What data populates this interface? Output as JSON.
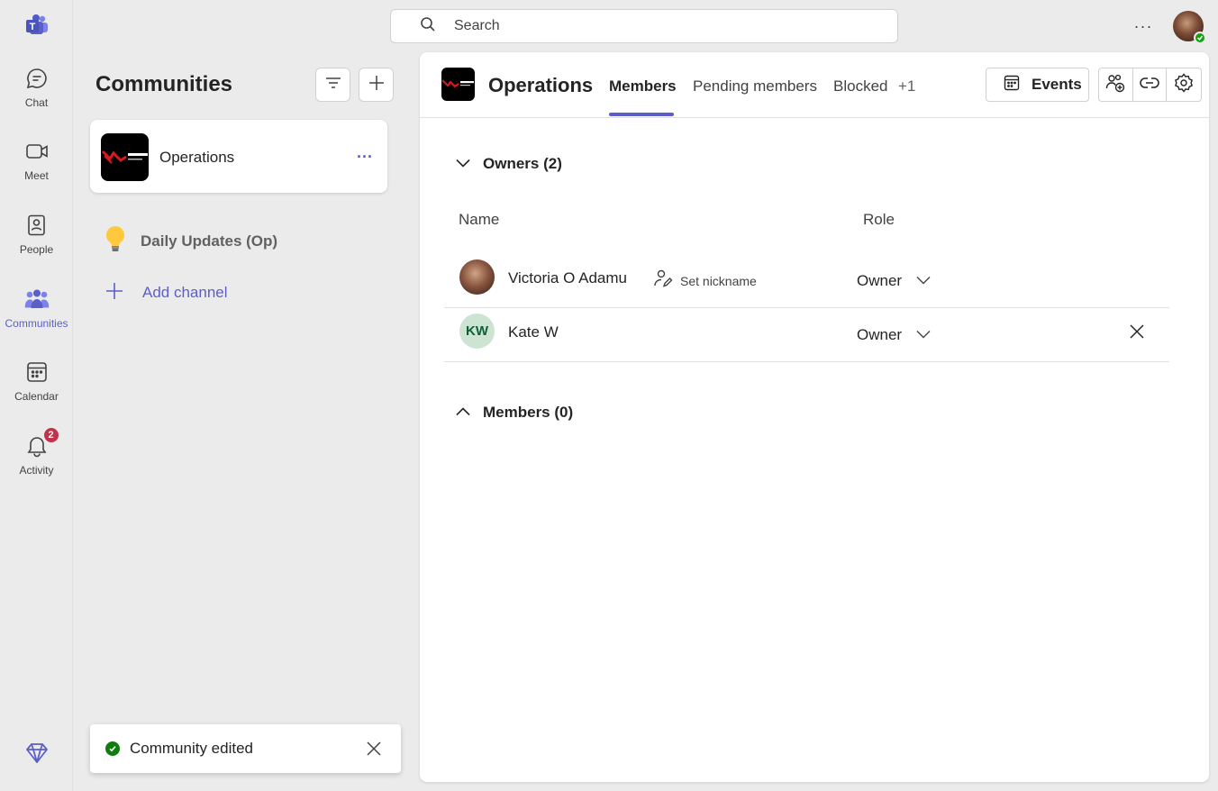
{
  "rail": {
    "items": [
      {
        "label": "Chat",
        "icon": "chat-icon"
      },
      {
        "label": "Meet",
        "icon": "video-icon"
      },
      {
        "label": "People",
        "icon": "contacts-icon"
      },
      {
        "label": "Communities",
        "icon": "communities-icon"
      },
      {
        "label": "Calendar",
        "icon": "calendar-icon"
      },
      {
        "label": "Activity",
        "icon": "bell-icon",
        "badge": "2"
      }
    ],
    "active": "Communities"
  },
  "search": {
    "placeholder": "Search"
  },
  "panel": {
    "title": "Communities",
    "community": {
      "name": "Operations"
    },
    "channels": [
      {
        "name": "Daily Updates (Op)"
      }
    ],
    "add_channel": "Add channel"
  },
  "toast": {
    "text": "Community edited"
  },
  "main": {
    "title": "Operations",
    "tabs": [
      {
        "label": "Members",
        "active": true
      },
      {
        "label": "Pending members"
      },
      {
        "label": "Blocked"
      },
      {
        "label": "+1"
      }
    ],
    "events_label": "Events",
    "owners_section": "Owners (2)",
    "columns": {
      "name": "Name",
      "role": "Role"
    },
    "owners": [
      {
        "name": "Victoria O Adamu",
        "role": "Owner",
        "nickname": "Set nickname"
      },
      {
        "name": "Kate W",
        "initials": "KW",
        "role": "Owner"
      }
    ],
    "members_section": "Members (0)"
  },
  "colors": {
    "accent": "#5b5fc7",
    "badge": "#c4314b",
    "presence": "#13a10e"
  }
}
